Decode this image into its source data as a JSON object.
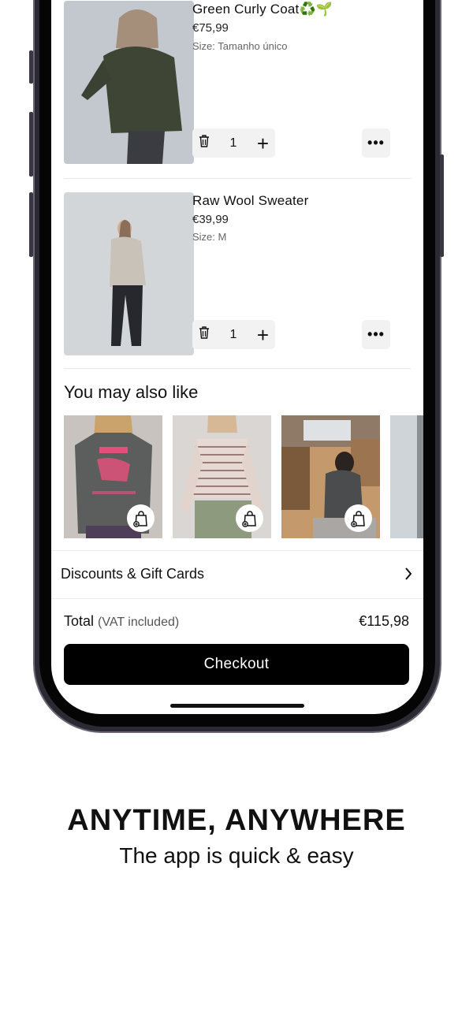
{
  "cart": {
    "items": [
      {
        "title": "Green Curly Coat",
        "title_emoji": "♻️🌱",
        "price": "€75,99",
        "size": "Size: Tamanho único",
        "quantity": "1"
      },
      {
        "title": "Raw Wool Sweater",
        "title_emoji": "",
        "price": "€39,99",
        "size": "Size: M",
        "quantity": "1"
      }
    ],
    "plus_glyph": "+",
    "more_glyph": "•••"
  },
  "recommendations": {
    "heading": "You may also like",
    "products": [
      {
        "image": "grey-tshirt-back-print-photo"
      },
      {
        "image": "striped-turtleneck-photo"
      },
      {
        "image": "grey-tshirt-kitchen-photo"
      },
      {
        "image": "partial-product-photo"
      }
    ],
    "add_icon": "shopping-bag-plus-icon"
  },
  "discounts": {
    "label": "Discounts & Gift Cards",
    "icon": "chevron-right-icon"
  },
  "total": {
    "label": "Total",
    "vat_note": "(VAT included)",
    "value": "€115,98"
  },
  "checkout": {
    "label": "Checkout"
  },
  "caption": {
    "title": "ANYTIME, ANYWHERE",
    "subtitle": "The app is quick & easy"
  },
  "colors": {
    "primary": "#000000",
    "background": "#ffffff",
    "chip": "#f2f2f2",
    "frame": "#2b2a33"
  }
}
